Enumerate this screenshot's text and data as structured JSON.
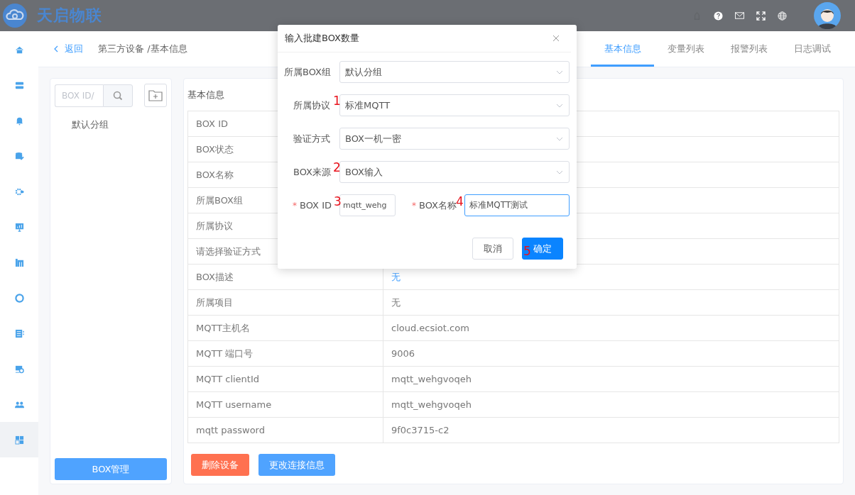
{
  "header": {
    "brand": "天启物联"
  },
  "sidebar": {
    "items": [
      {
        "selected": false
      },
      {
        "selected": false
      },
      {
        "selected": false
      },
      {
        "selected": false
      },
      {
        "selected": false
      },
      {
        "selected": false
      },
      {
        "selected": false
      },
      {
        "selected": false
      },
      {
        "selected": false
      },
      {
        "selected": false
      },
      {
        "selected": false
      },
      {
        "selected": true
      }
    ]
  },
  "topbar": {
    "back": "返回",
    "breadcrumb": "第三方设备 /基本信息"
  },
  "tabs": [
    {
      "label": "基本信息",
      "selected": true
    },
    {
      "label": "变量列表",
      "selected": false
    },
    {
      "label": "报警列表",
      "selected": false
    },
    {
      "label": "日志调试",
      "selected": false
    }
  ],
  "group_panel": {
    "search_placeholder": "BOX ID/",
    "groups": [
      "默认分组"
    ],
    "manage_button": "BOX管理"
  },
  "info_panel": {
    "title": "基本信息",
    "rows": [
      {
        "label": "BOX ID"
      },
      {
        "label": "BOX状态"
      },
      {
        "label": "BOX名称"
      },
      {
        "label": "所属BOX组"
      },
      {
        "label": "所属协议"
      },
      {
        "label": "请选择验证方式"
      },
      {
        "label": "BOX描述",
        "value": "无",
        "link": true
      },
      {
        "label": "所属项目",
        "value": "无",
        "link": false
      },
      {
        "label": "MQTT主机名",
        "value": "cloud.ecsiot.com",
        "link": false
      },
      {
        "label": "MQTT 端口号",
        "value": "9006",
        "link": false
      },
      {
        "label": "MQTT clientId",
        "value": "mqtt_wehgvoqeh",
        "link": false
      },
      {
        "label": "MQTT username",
        "value": "mqtt_wehgvoqeh",
        "link": false
      },
      {
        "label": "mqtt password",
        "value": "9f0c3715-c2",
        "link": false
      }
    ],
    "buttons": [
      {
        "label": "删除设备",
        "kind": "danger"
      },
      {
        "label": "更改连接信息",
        "kind": "primary"
      }
    ]
  },
  "dialog": {
    "title": "输入批建BOX数量",
    "rows": [
      {
        "fields": [
          {
            "kind": "select",
            "label": "所属BOX组",
            "value": "默认分组"
          }
        ]
      },
      {
        "fields": [
          {
            "kind": "select",
            "label": "所属协议",
            "value": "标准MQTT",
            "marker": "1"
          }
        ]
      },
      {
        "fields": [
          {
            "kind": "select",
            "label": "验证方式",
            "value": "BOX一机一密"
          }
        ]
      },
      {
        "fields": [
          {
            "kind": "select",
            "label": "BOX来源",
            "value": "BOX输入",
            "marker": "2"
          }
        ]
      },
      {
        "fields": [
          {
            "kind": "input",
            "label": "BOX ID",
            "required_mark": "*",
            "value": "mqtt_wehg",
            "marker": "3",
            "focused": false
          },
          {
            "kind": "input",
            "label": "BOX名称",
            "required_mark": "*",
            "value": "标准MQTT测试",
            "marker": "4",
            "focused": true
          }
        ]
      }
    ],
    "buttons": [
      {
        "label": "取消",
        "kind": "default"
      },
      {
        "label": "确定",
        "kind": "primary",
        "marker": "5"
      }
    ]
  }
}
